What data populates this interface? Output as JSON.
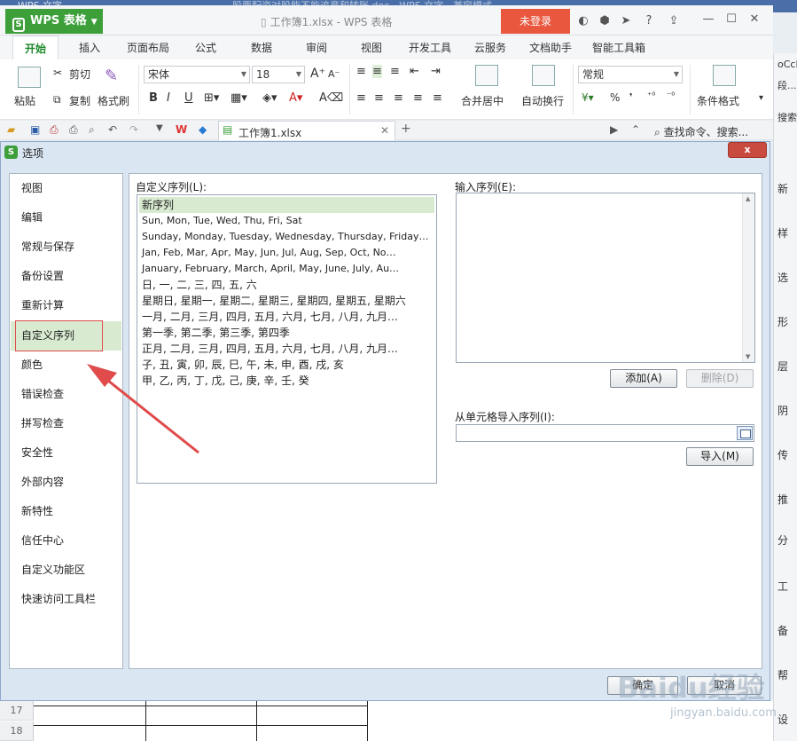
{
  "background_window": {
    "top_strip_left": "WPS 文字",
    "top_strip_title": "股票配资对股能不能追意和转账.doc - WPS 文字 - 兼容模式",
    "app_logo": "WPS 表格",
    "title": "工作簿1.xlsx - WPS 表格",
    "login_button": "未登录",
    "ribbon_tabs": [
      "开始",
      "插入",
      "页面布局",
      "公式",
      "数据",
      "审阅",
      "视图",
      "开发工具",
      "云服务",
      "文档助手",
      "智能工具箱"
    ],
    "ribbon": {
      "paste": "粘贴",
      "cut": "剪切",
      "copy": "复制",
      "format_painter": "格式刷",
      "font_name": "宋体",
      "font_size": "18",
      "bold": "B",
      "italic": "I",
      "underline": "U",
      "merge_center": "合并居中",
      "wrap_text": "自动换行",
      "number_format": "常规",
      "conditional_format": "条件格式",
      "percent": "%"
    },
    "qat_doc_tab": "工作簿1.xlsx",
    "search_command": "查找命令、搜索...",
    "right_pane_texts": [
      "oCcD",
      "段...",
      "搜索",
      "新",
      "样",
      "选",
      "形",
      "层",
      "阴",
      "传",
      "推",
      "分",
      "工",
      "备",
      "帮",
      "设"
    ],
    "sheet_rows": [
      "17",
      "18"
    ]
  },
  "dialog": {
    "title": "选项",
    "close": "x",
    "nav": [
      "视图",
      "编辑",
      "常规与保存",
      "备份设置",
      "重新计算",
      "自定义序列",
      "颜色",
      "错误检查",
      "拼写检查",
      "安全性",
      "外部内容",
      "新特性",
      "信任中心",
      "自定义功能区",
      "快速访问工具栏"
    ],
    "selected_nav": "自定义序列",
    "custom_list_label": "自定义序列(L):",
    "custom_lists": [
      "新序列",
      "Sun, Mon, Tue, Wed, Thu, Fri, Sat",
      "Sunday, Monday, Tuesday, Wednesday, Thursday, Friday…",
      "Jan, Feb, Mar, Apr, May, Jun, Jul, Aug, Sep, Oct, No…",
      "January, February, March, April, May, June, July, Au…",
      "日, 一, 二, 三, 四, 五, 六",
      "星期日, 星期一, 星期二, 星期三, 星期四, 星期五, 星期六",
      "一月, 二月, 三月, 四月, 五月, 六月, 七月, 八月, 九月…",
      "第一季, 第二季, 第三季, 第四季",
      "正月, 二月, 三月, 四月, 五月, 六月, 七月, 八月, 九月…",
      "子, 丑, 寅, 卯, 辰, 巳, 午, 未, 申, 酉, 戌, 亥",
      "甲, 乙, 丙, 丁, 戊, 己, 庚, 辛, 壬, 癸"
    ],
    "input_list_label": "输入序列(E):",
    "add_button": "添加(A)",
    "delete_button": "删除(D)",
    "import_label": "从单元格导入序列(I):",
    "import_button": "导入(M)",
    "ok_button": "确定",
    "cancel_button": "取消"
  },
  "watermark": {
    "brand": "Baidu经验",
    "url": "jingyan.baidu.com"
  },
  "colors": {
    "accent_green": "#3c9f3a",
    "login_red": "#e9573f",
    "highlight_red": "#e04b4b",
    "selection_green": "#d8ebd0"
  }
}
